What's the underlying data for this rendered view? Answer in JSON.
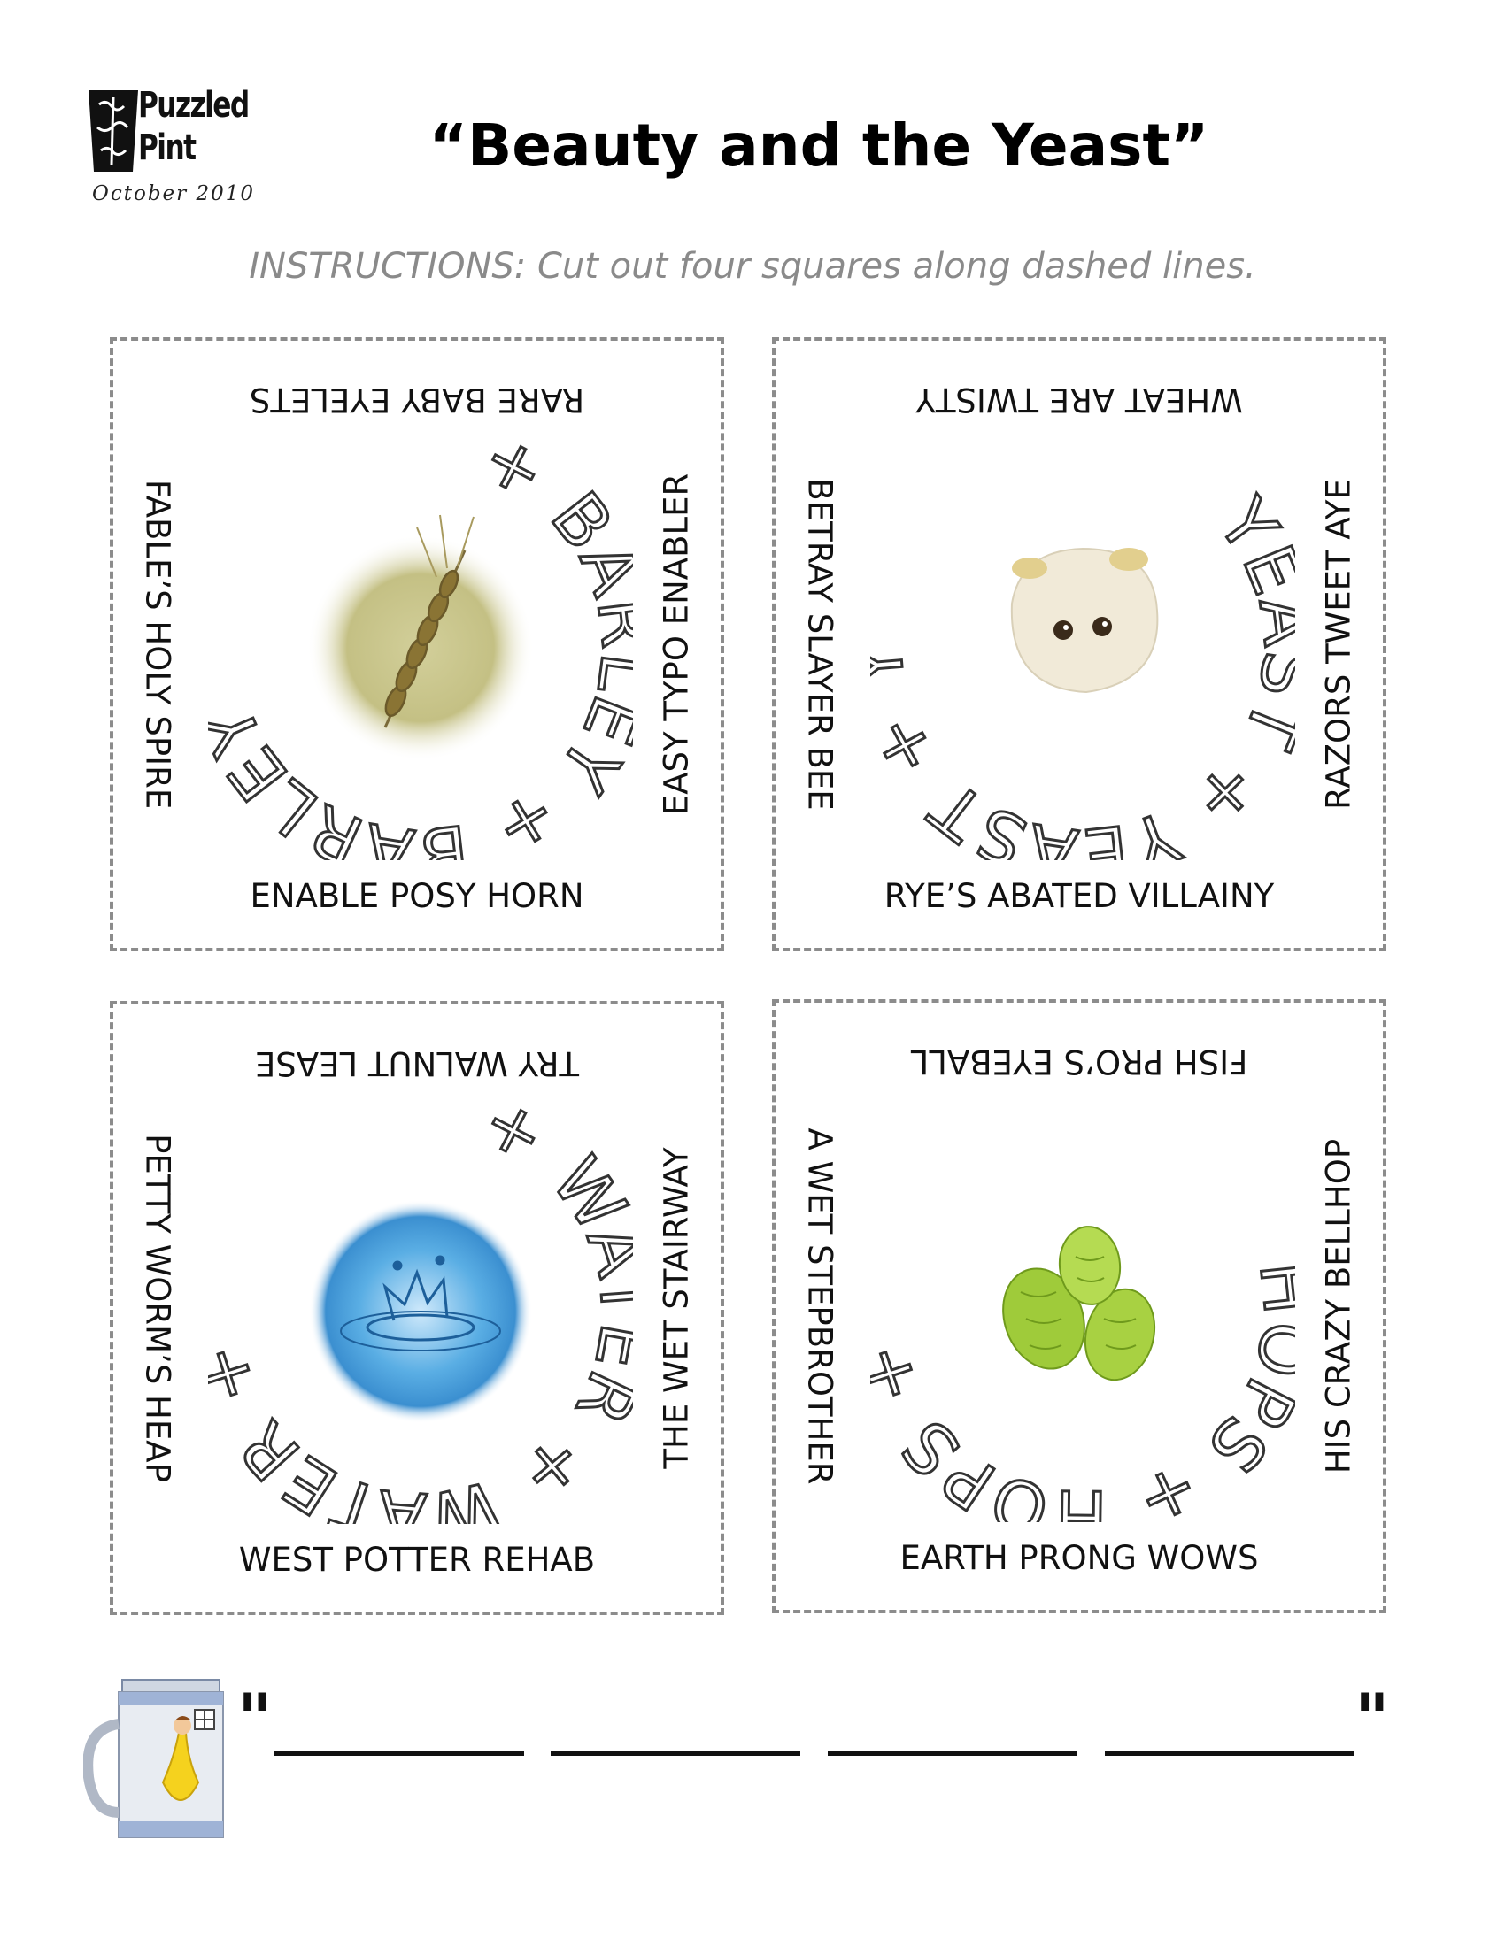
{
  "header": {
    "logo_line1": "Puzzled",
    "logo_line2": "Pint",
    "logo_date": "October 2010",
    "title": "“Beauty and the Yeast”",
    "instructions": "INSTRUCTIONS: Cut out four squares along dashed lines."
  },
  "squares": [
    {
      "ring_text": "+ BARLEY + BARLEY + BARLEY",
      "image": "barley-ear",
      "top": "RARE BABY EYELETS",
      "left": "FABLE’S HOLY SPIRE",
      "right": "EASY TYPO ENABLER",
      "bottom": "ENABLE POSY HORN"
    },
    {
      "ring_text": "YEAST + YEAST + YEAST +",
      "image": "yeast-cell-plush",
      "top": "WHEAT ARE TWISTY",
      "left": "BETRAY SLAYER BEE",
      "right": "RAZORS TWEET AYE",
      "bottom": "RYE’S ABATED VILLAINY"
    },
    {
      "ring_text": "+ WATER + WATER + WATER",
      "image": "water-splash",
      "top": "TRY WALNUT LEASE",
      "left": "PETTY WORM’S HEAP",
      "right": "THE WET STAIRWAY",
      "bottom": "WEST POTTER REHAB"
    },
    {
      "ring_text": "HOPS + HOPS + HOPS +",
      "image": "hop-cones",
      "top": "FISH PRO’S EYEBALL",
      "left": "A WET STEPBROTHER",
      "right": "HIS CRAZY BELLHOP",
      "bottom": "EARTH PRONG WOWS"
    }
  ],
  "answer": {
    "open_quote": "\"",
    "close_quote": "\"",
    "blank_count": 4
  },
  "colors": {
    "dash": "#8c8c8c",
    "instructions": "#8a8a8a"
  }
}
